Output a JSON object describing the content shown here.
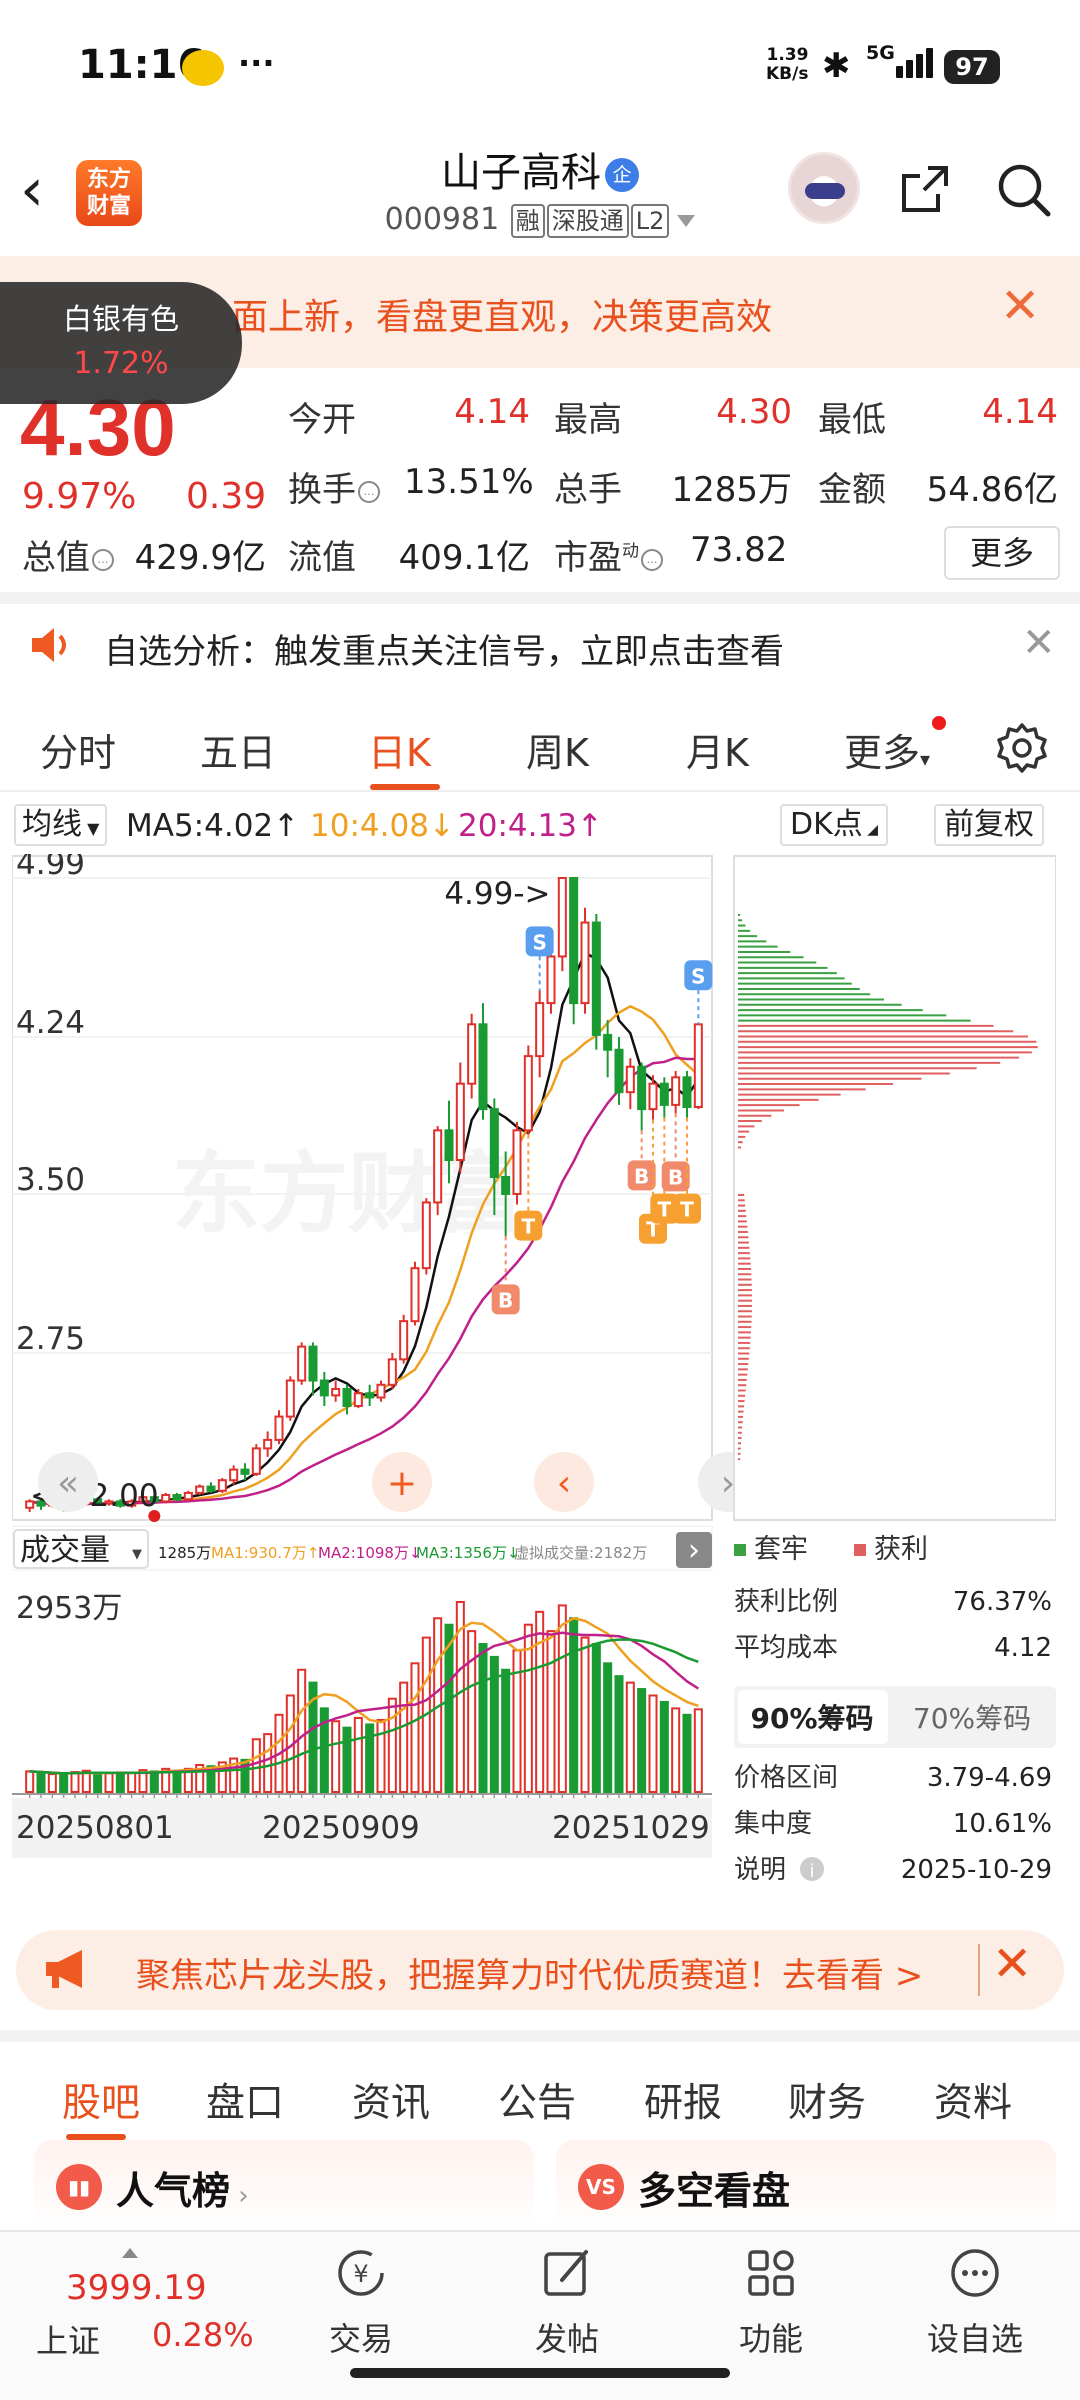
{
  "status": {
    "time": "11:16",
    "net_speed_value": "1.39",
    "net_speed_unit": "KB/s",
    "signal": "5G",
    "battery": "97"
  },
  "header": {
    "logo_line1": "东方",
    "logo_line2": "财富",
    "stock_name": "山子高科",
    "qi_badge": "企",
    "stock_code": "000981",
    "tag1": "融",
    "tag2": "深股通",
    "tag3": "L2"
  },
  "banner": {
    "text": "面上新，看盘更直观，决策更高效"
  },
  "float_tip": {
    "name": "白银有色",
    "pct": "1.72%"
  },
  "quote": {
    "price": "4.30",
    "change_pct": "9.97%",
    "change": "0.39",
    "open_label": "今开",
    "open": "4.14",
    "high_label": "最高",
    "high": "4.30",
    "low_label": "最低",
    "low": "4.14",
    "turnover_label": "换手",
    "turnover": "13.51%",
    "volume_label": "总手",
    "volume": "1285万",
    "amount_label": "金额",
    "amount": "54.86亿",
    "mktcap_label": "总值",
    "mktcap": "429.9亿",
    "float_label": "流值",
    "float_cap": "409.1亿",
    "pe_label": "市盈",
    "pe_sup": "动",
    "pe": "73.82",
    "more": "更多"
  },
  "notice": {
    "text": "自选分析：触发重点关注信号，立即点击查看"
  },
  "period_tabs": [
    "分时",
    "五日",
    "日K",
    "周K",
    "月K",
    "更多"
  ],
  "active_period": "日K",
  "ma_line": {
    "selector": "均线",
    "ma5": "MA5:4.02",
    "ma10": "10:4.08",
    "ma20": "20:4.13",
    "dk_btn": "DK点",
    "fq_btn": "前复权"
  },
  "colors": {
    "up": "#e0302a",
    "down": "#1a9a32",
    "ma5": "#111111",
    "ma10": "#f0a020",
    "ma20": "#c0208a",
    "accent": "#e8501e"
  },
  "chart_data": {
    "type": "candlestick",
    "price_axis": [
      "4.99",
      "4.24",
      "3.50",
      "2.75"
    ],
    "max_label": "4.99->",
    "min_label": "<---2.00",
    "ylim": [
      2.0,
      4.99
    ],
    "candles": [
      [
        2.02,
        2.05,
        2.0,
        2.06
      ],
      [
        2.05,
        2.03,
        2.01,
        2.06
      ],
      [
        2.03,
        2.04,
        2.02,
        2.05
      ],
      [
        2.04,
        2.02,
        2.0,
        2.05
      ],
      [
        2.02,
        2.04,
        2.01,
        2.05
      ],
      [
        2.04,
        2.06,
        2.03,
        2.07
      ],
      [
        2.06,
        2.04,
        2.03,
        2.07
      ],
      [
        2.04,
        2.05,
        2.03,
        2.06
      ],
      [
        2.05,
        2.03,
        2.02,
        2.06
      ],
      [
        2.03,
        2.05,
        2.02,
        2.06
      ],
      [
        2.05,
        2.07,
        2.04,
        2.08
      ],
      [
        2.07,
        2.05,
        2.04,
        2.08
      ],
      [
        2.05,
        2.08,
        2.04,
        2.09
      ],
      [
        2.08,
        2.06,
        2.05,
        2.09
      ],
      [
        2.06,
        2.09,
        2.05,
        2.1
      ],
      [
        2.09,
        2.12,
        2.08,
        2.13
      ],
      [
        2.12,
        2.1,
        2.09,
        2.14
      ],
      [
        2.1,
        2.15,
        2.09,
        2.16
      ],
      [
        2.15,
        2.2,
        2.13,
        2.22
      ],
      [
        2.2,
        2.18,
        2.15,
        2.23
      ],
      [
        2.18,
        2.3,
        2.17,
        2.32
      ],
      [
        2.3,
        2.34,
        2.26,
        2.38
      ],
      [
        2.34,
        2.45,
        2.32,
        2.48
      ],
      [
        2.45,
        2.62,
        2.43,
        2.64
      ],
      [
        2.62,
        2.78,
        2.6,
        2.8
      ],
      [
        2.78,
        2.62,
        2.55,
        2.8
      ],
      [
        2.62,
        2.55,
        2.5,
        2.66
      ],
      [
        2.55,
        2.58,
        2.52,
        2.62
      ],
      [
        2.58,
        2.5,
        2.46,
        2.6
      ],
      [
        2.5,
        2.56,
        2.49,
        2.58
      ],
      [
        2.56,
        2.54,
        2.5,
        2.6
      ],
      [
        2.54,
        2.6,
        2.52,
        2.62
      ],
      [
        2.6,
        2.72,
        2.58,
        2.75
      ],
      [
        2.72,
        2.9,
        2.7,
        2.93
      ],
      [
        2.9,
        3.15,
        2.88,
        3.18
      ],
      [
        3.15,
        3.46,
        3.12,
        3.48
      ],
      [
        3.46,
        3.8,
        3.4,
        3.82
      ],
      [
        3.8,
        3.66,
        3.55,
        3.94
      ],
      [
        3.66,
        4.02,
        3.6,
        4.12
      ],
      [
        4.02,
        4.3,
        3.95,
        4.35
      ],
      [
        4.3,
        3.9,
        3.85,
        4.4
      ],
      [
        3.9,
        3.58,
        3.4,
        3.95
      ],
      [
        3.58,
        3.5,
        3.3,
        3.7
      ],
      [
        3.5,
        3.8,
        3.45,
        3.84
      ],
      [
        3.8,
        4.15,
        3.78,
        4.2
      ],
      [
        4.15,
        4.4,
        4.05,
        4.46
      ],
      [
        4.4,
        4.62,
        4.35,
        4.7
      ],
      [
        4.62,
        4.99,
        4.55,
        4.99
      ],
      [
        4.99,
        4.4,
        4.3,
        4.99
      ],
      [
        4.4,
        4.78,
        4.35,
        4.85
      ],
      [
        4.78,
        4.25,
        4.18,
        4.82
      ],
      [
        4.25,
        4.18,
        4.05,
        4.32
      ],
      [
        4.18,
        3.98,
        3.92,
        4.24
      ],
      [
        3.98,
        4.1,
        3.9,
        4.14
      ],
      [
        4.1,
        3.9,
        3.8,
        4.12
      ],
      [
        3.9,
        4.02,
        3.85,
        4.06
      ],
      [
        4.02,
        3.92,
        3.86,
        4.05
      ],
      [
        3.92,
        4.05,
        3.88,
        4.08
      ],
      [
        4.05,
        3.91,
        3.86,
        4.08
      ],
      [
        3.91,
        4.3,
        3.9,
        4.3
      ]
    ],
    "signals": [
      {
        "type": "S",
        "index": 45
      },
      {
        "type": "B",
        "index": 42
      },
      {
        "type": "T",
        "index": 44
      },
      {
        "type": "S",
        "index": 59
      },
      {
        "type": "B",
        "index": 54
      },
      {
        "type": "T",
        "index": 55
      },
      {
        "type": "T",
        "index": 56
      },
      {
        "type": "B",
        "index": 57
      },
      {
        "type": "T",
        "index": 58
      }
    ],
    "volume_label": "成交量",
    "volume_stats": [
      "1285万",
      "MA1:930.7万↑",
      "MA2:1098万↓",
      "MA3:1356万↓",
      "虚拟成交量:2182万"
    ],
    "volume_axis_max": "2953万",
    "volumes": [
      320,
      300,
      280,
      260,
      310,
      330,
      300,
      290,
      280,
      300,
      340,
      320,
      360,
      330,
      360,
      420,
      400,
      460,
      520,
      500,
      820,
      900,
      1200,
      1500,
      1900,
      1700,
      1300,
      1100,
      1000,
      1150,
      1050,
      1120,
      1450,
      1700,
      2000,
      2400,
      2700,
      2600,
      2953,
      2500,
      2300,
      2100,
      1900,
      2200,
      2600,
      2800,
      2500,
      2900,
      2700,
      2400,
      2300,
      2000,
      1800,
      1700,
      1600,
      1500,
      1400,
      1300,
      1200,
      1285
    ],
    "dates": [
      "20250801",
      "20250909",
      "20251029"
    ],
    "chip": {
      "legend_trapped": "套牢",
      "legend_profit": "获利",
      "rows": [
        {
          "label": "获利比例",
          "value": "76.37%"
        },
        {
          "label": "平均成本",
          "value": "4.12"
        }
      ],
      "tab_90": "90%筹码",
      "tab_70": "70%筹码",
      "rows2": [
        {
          "label": "价格区间",
          "value": "3.79-4.69"
        },
        {
          "label": "集中度",
          "value": "10.61%"
        },
        {
          "label": "说明",
          "value": "2025-10-29"
        }
      ]
    }
  },
  "promo": {
    "text": "聚焦芯片龙头股，把握算力时代优质赛道！去看看 >"
  },
  "content_tabs": [
    "股吧",
    "盘口",
    "资讯",
    "公告",
    "研报",
    "财务",
    "资料"
  ],
  "cards": [
    {
      "title": "人气榜",
      "icon": "rank-icon"
    },
    {
      "title": "多空看盘",
      "icon": "vs-icon"
    }
  ],
  "cards_vs": "VS",
  "bottom_nav": {
    "index_value": "3999.19",
    "index_name": "上证",
    "index_pct": "0.28%",
    "items": [
      "交易",
      "发帖",
      "功能",
      "设自选"
    ]
  }
}
